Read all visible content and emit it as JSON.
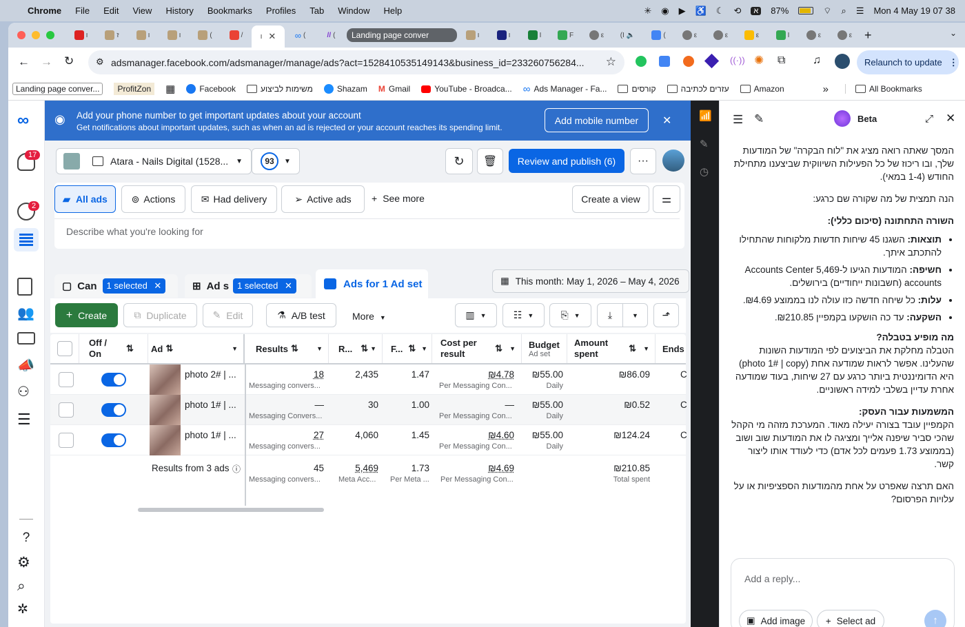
{
  "menubar": {
    "app": "Chrome",
    "items": [
      "File",
      "Edit",
      "View",
      "History",
      "Bookmarks",
      "Profiles",
      "Tab",
      "Window",
      "Help"
    ],
    "battery": "87%",
    "clock": "Mon 4 May  19 07 38",
    "input_lang": "א"
  },
  "tabs": {
    "grouped_label": "Landing page conver",
    "items": [
      "ו",
      "ז",
      "ו",
      "ו",
      "(",
      "/",
      "ו",
      "(",
      "(",
      "ו",
      "ו",
      "I",
      "F",
      "ε",
      "(I",
      "(",
      "ε",
      "ε",
      "ε",
      "I",
      "ε",
      "ε"
    ]
  },
  "toolbar": {
    "url": "adsmanager.facebook.com/adsmanager/manage/ads?act=1528410535149143&business_id=233260756284...",
    "relaunch": "Relaunch to update"
  },
  "bookmarks": [
    {
      "label": "Landing page conver...",
      "icon": "tab-icon"
    },
    {
      "label": "ProfitZon",
      "icon": "none"
    },
    {
      "label": "Facebook",
      "icon": "facebook-icon"
    },
    {
      "label": "משימות לביצוע",
      "icon": "folder-icon"
    },
    {
      "label": "Shazam",
      "icon": "shazam-icon"
    },
    {
      "label": "Gmail",
      "icon": "gmail-icon"
    },
    {
      "label": "YouTube - Broadca...",
      "icon": "youtube-icon"
    },
    {
      "label": "Ads Manager - Fa...",
      "icon": "meta-icon"
    },
    {
      "label": "קורסים",
      "icon": "folder-icon"
    },
    {
      "label": "עזרים לכתיבה",
      "icon": "folder-icon"
    },
    {
      "label": "Amazon",
      "icon": "folder-icon"
    }
  ],
  "all_bookmarks": "All Bookmarks",
  "nav": {
    "notifications_badge": "17",
    "messages_badge": "2"
  },
  "banner": {
    "title": "Add your phone number to get important updates about your account",
    "subtitle": "Get notifications about important updates, such as when an ad is rejected or your account reaches its spending limit.",
    "button": "Add mobile number"
  },
  "account": {
    "name": "Atara - Nails Digital (1528...",
    "score": "93",
    "review": "Review and publish (6)"
  },
  "filters": {
    "all_ads": "All ads",
    "actions": "Actions",
    "had_delivery": "Had delivery",
    "active_ads": "Active ads",
    "see_more": "See more",
    "create_view": "Create a view"
  },
  "search": {
    "placeholder": "Describe what you're looking for"
  },
  "levels": {
    "campaign": "Can",
    "campaign_selected": "1 selected",
    "adset": "Ad s",
    "adset_selected": "1 selected",
    "ads": "Ads for 1 Ad set",
    "date": "This month: May 1, 2026 – May 4, 2026"
  },
  "actions": {
    "create": "Create",
    "duplicate": "Duplicate",
    "edit": "Edit",
    "abtest": "A/B test",
    "more": "More"
  },
  "table": {
    "headers": {
      "onoff": "Off / On",
      "ad": "Ad",
      "results": "Results",
      "reach": "R...",
      "freq": "F...",
      "cpr": "Cost per result",
      "budget": "Budget",
      "budget_sub": "Ad set",
      "spent": "Amount spent",
      "ends": "Ends"
    },
    "rows": [
      {
        "name": "photo 2# | ...",
        "results": "18",
        "results_sub": "Messaging convers...",
        "reach": "2,435",
        "freq": "1.47",
        "cpr": "₪4.78",
        "cpr_sub": "Per Messaging Con...",
        "budget": "₪55.00",
        "budget_sub": "Daily",
        "spent": "₪86.09",
        "ends": "C"
      },
      {
        "name": "photo 1# | ...",
        "results": "—",
        "results_sub": "Messaging Convers...",
        "reach": "30",
        "freq": "1.00",
        "cpr": "—",
        "cpr_sub": "Per Messaging Con...",
        "budget": "₪55.00",
        "budget_sub": "Daily",
        "spent": "₪0.52",
        "ends": "C"
      },
      {
        "name": "photo 1# | ...",
        "results": "27",
        "results_sub": "Messaging convers...",
        "reach": "4,060",
        "freq": "1.45",
        "cpr": "₪4.60",
        "cpr_sub": "Per Messaging Con...",
        "budget": "₪55.00",
        "budget_sub": "Daily",
        "spent": "₪124.24",
        "ends": "C"
      }
    ],
    "totals": {
      "label": "Results from 3 ads",
      "results": "45",
      "results_sub": "Messaging convers...",
      "reach": "5,469",
      "reach_sub": "Meta Acc...",
      "freq": "1.73",
      "freq_sub": "Per Meta ...",
      "cpr": "₪4.69",
      "cpr_sub": "Per Messaging Con...",
      "spent": "₪210.85",
      "spent_sub": "Total spent"
    }
  },
  "assistant": {
    "label": "Beta",
    "intro": "המסך שאתה רואה מציג את \"לוח הבקרה\" של המודעות שלך, ובו ריכוז של כל הפעילות השיווקית שביצענו מתחילת החודש (1-4 במאי).",
    "lead": "הנה תמצית של מה שקורה שם כרגע:",
    "h1": "השורה התחתונה (סיכום כללי):",
    "b1_t": "תוצאות:",
    "b1": " השגנו 45 שיחות חדשות מלקוחות שהתחילו להתכתב איתך.",
    "b2_t": "חשיפה:",
    "b2": " המודעות הגיעו ל-5,469 Accounts Center accounts (חשבונות ייחודיים) בירושלים.",
    "b3_t": "עלות:",
    "b3": " כל שיחה חדשה כזו עולה לנו בממוצע ₪4.69.",
    "b4_t": "השקעה:",
    "b4": " עד כה הושקעו בקמפיין ₪210.85.",
    "h2": "מה מופיע בטבלה?",
    "p2": "הטבלה מחלקת את הביצועים לפי המודעות השונות שהעלינו. אפשר לראות שמודעה אחת (photo 1# | copy) היא הדומיננטית ביותר כרגע עם 27 שיחות, בעוד שמודעה אחרת עדיין בשלבי למידה ראשוניים.",
    "h3": "המשמעות עבור העסק:",
    "p3": "הקמפיין עובד בצורה יעילה מאוד. המערכת מזהה מי הקהל שהכי סביר שיפנה אלייך ומציגה לו את המודעות שוב ושוב (בממוצע 1.73 פעמים לכל אדם) כדי לעודד אותו ליצור קשר.",
    "p4": "האם תרצה שאפרט על אחת מהמודעות הספציפיות או על עלויות הפרסום?",
    "reply_placeholder": "Add a reply...",
    "add_image": "Add image",
    "select_ad": "Select ad"
  }
}
